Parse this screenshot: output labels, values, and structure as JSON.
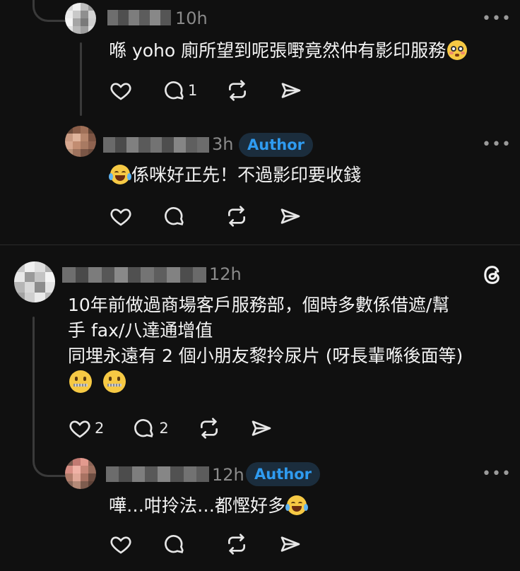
{
  "colors": {
    "background": "#101010",
    "accent": "#2f9bf0",
    "badge_bg": "#1b2d3d",
    "muted": "#8a8a8a"
  },
  "comments": [
    {
      "time": "10h",
      "text": "喺 yoho 廁所望到呢張嘢竟然仲有影印服務",
      "emoji": "flushed-face",
      "likes": "",
      "replies": "1"
    },
    {
      "time": "3h",
      "badge": "Author",
      "text": "係咪好正先！不過影印要收錢",
      "emoji": "tears-of-joy-face",
      "likes": "",
      "replies": ""
    },
    {
      "time": "12h",
      "text_lines": [
        "10年前做過商場客戶服務部，個時多數係借遮/幫",
        "手 fax/八達通增值",
        "同埋永遠有 2 個小朋友黎拎尿片 (呀長輩喺後面等)"
      ],
      "emoji": "zipper-mouth-face",
      "likes": "2",
      "replies": "2"
    },
    {
      "time": "12h",
      "badge": "Author",
      "text": "嘩…咁拎法…都慳好多",
      "emoji": "tears-of-joy-face",
      "likes": "",
      "replies": ""
    }
  ],
  "threads_logo": "threads-logo-icon",
  "more_glyph": "•••"
}
